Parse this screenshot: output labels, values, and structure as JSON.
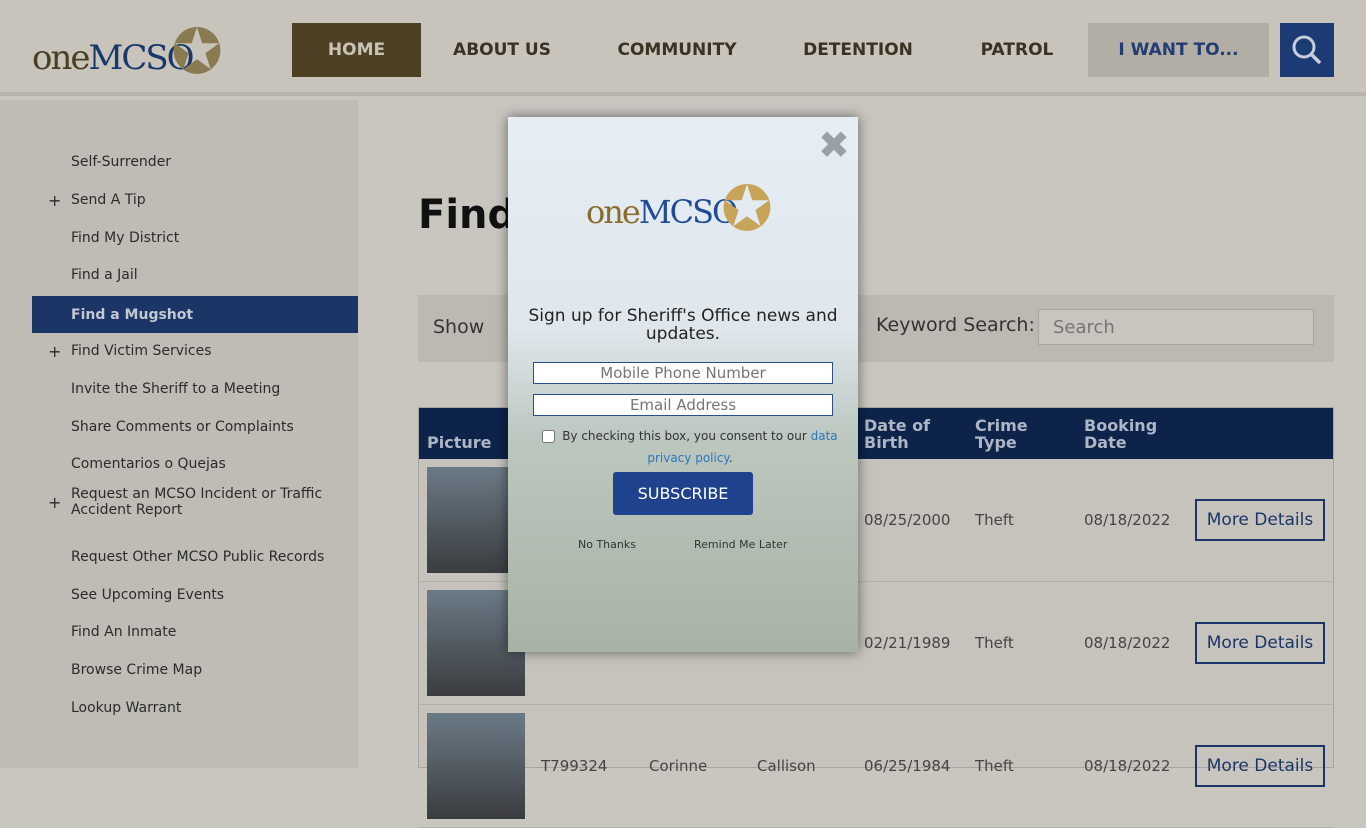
{
  "header": {
    "logo_text_one": "one",
    "logo_text_mcso": "MCSO",
    "nav": [
      "HOME",
      "ABOUT US",
      "COMMUNITY",
      "DETENTION",
      "PATROL"
    ],
    "cta": "I WANT TO...",
    "search_icon": "search-icon"
  },
  "sidebar": {
    "items": [
      {
        "label": "Self-Surrender",
        "plus": ""
      },
      {
        "label": "Send A Tip",
        "plus": "+"
      },
      {
        "label": "Find My District",
        "plus": ""
      },
      {
        "label": "Find a Jail",
        "plus": ""
      },
      {
        "label": "Find a Mugshot",
        "plus": "",
        "active": true
      },
      {
        "label": "Find Victim Services",
        "plus": "+"
      },
      {
        "label": "Invite the Sheriff to a Meeting",
        "plus": ""
      },
      {
        "label": "Share Comments or Complaints",
        "plus": ""
      },
      {
        "label": "Comentarios o Quejas",
        "plus": ""
      },
      {
        "label": "Request an MCSO Incident or Traffic Accident Report",
        "plus": "+"
      },
      {
        "label": "Request Other MCSO Public Records",
        "plus": ""
      },
      {
        "label": "See Upcoming Events",
        "plus": ""
      },
      {
        "label": "Find An Inmate",
        "plus": ""
      },
      {
        "label": "Browse Crime Map",
        "plus": ""
      },
      {
        "label": "Lookup Warrant",
        "plus": ""
      }
    ]
  },
  "main": {
    "title": "Find",
    "show_label": "Show",
    "keyword_label": "Keyword Search:",
    "search_placeholder": "Search",
    "table": {
      "headers": [
        "Picture",
        "Date of Birth",
        "Crime Type",
        "Booking Date"
      ],
      "rows": [
        {
          "booking": "",
          "first": "",
          "last": "",
          "dob": "08/25/2000",
          "crime": "Theft",
          "date": "08/18/2022",
          "action": "More Details"
        },
        {
          "booking": "",
          "first": "",
          "last": "",
          "dob": "02/21/1989",
          "crime": "Theft",
          "date": "08/18/2022",
          "action": "More Details"
        },
        {
          "booking": "T799324",
          "first": "Corinne",
          "last": "Callison",
          "dob": "06/25/1984",
          "crime": "Theft",
          "date": "08/18/2022",
          "action": "More Details"
        }
      ]
    }
  },
  "modal": {
    "title": "Sign up for Sheriff's Office news and updates.",
    "phone_placeholder": "Mobile Phone Number",
    "email_placeholder": "Email Address",
    "consent_text": "By checking this box, you consent to our ",
    "consent_link": "data privacy policy",
    "consent_end": ".",
    "subscribe": "SUBSCRIBE",
    "no_thanks": "No Thanks",
    "remind": "Remind Me Later"
  }
}
